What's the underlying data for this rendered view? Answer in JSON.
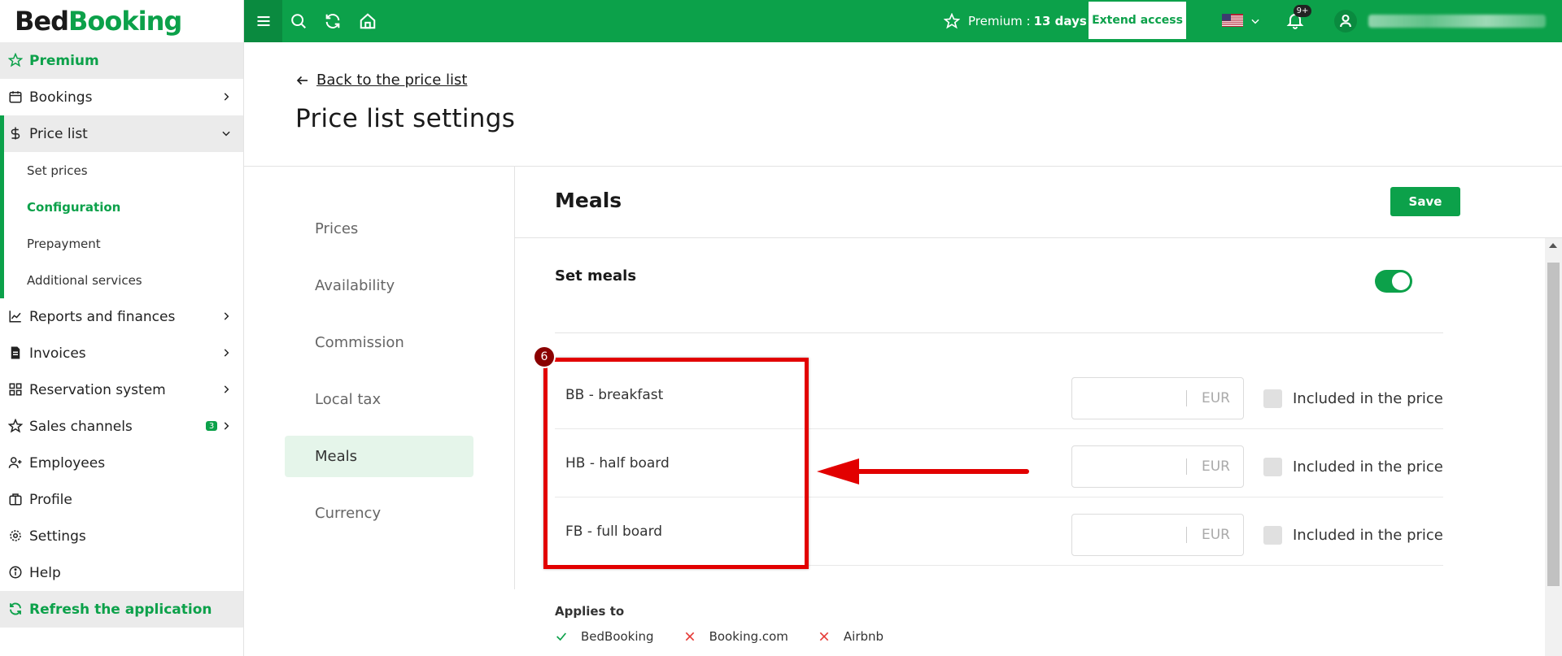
{
  "brand": {
    "part1": "Bed",
    "part2": "Booking"
  },
  "sidebar": {
    "items": [
      {
        "label": "Premium",
        "icon": "star-icon"
      },
      {
        "label": "Bookings",
        "icon": "calendar-icon"
      },
      {
        "label": "Price list",
        "icon": "dollar-icon"
      },
      {
        "label": "Reports and finances",
        "icon": "chart-icon"
      },
      {
        "label": "Invoices",
        "icon": "invoice-icon"
      },
      {
        "label": "Reservation system",
        "icon": "grid-icon"
      },
      {
        "label": "Sales channels",
        "icon": "star-icon",
        "badge": "3"
      },
      {
        "label": "Employees",
        "icon": "user-plus-icon"
      },
      {
        "label": "Profile",
        "icon": "building-icon"
      },
      {
        "label": "Settings",
        "icon": "gear-icon"
      },
      {
        "label": "Help",
        "icon": "info-icon"
      },
      {
        "label": "Refresh the application",
        "icon": "refresh-icon"
      }
    ],
    "price_list_sub": [
      "Set prices",
      "Configuration",
      "Prepayment",
      "Additional services"
    ]
  },
  "topbar": {
    "premium_label": "Premium :",
    "premium_days": "13 days",
    "extend_label": "Extend access",
    "notification_count": "9+"
  },
  "header": {
    "back_label": "Back to the price list",
    "title": "Price list settings"
  },
  "settings_nav": [
    "Prices",
    "Availability",
    "Commission",
    "Local tax",
    "Meals",
    "Currency"
  ],
  "main": {
    "title": "Meals",
    "save_label": "Save",
    "set_meals_label": "Set meals",
    "set_meals_enabled": true,
    "meals": [
      {
        "name": "BB - breakfast",
        "currency": "EUR",
        "included_label": "Included in the price"
      },
      {
        "name": "HB - half board",
        "currency": "EUR",
        "included_label": "Included in the price"
      },
      {
        "name": "FB - full board",
        "currency": "EUR",
        "included_label": "Included in the price"
      }
    ],
    "applies_label": "Applies to",
    "applies": [
      {
        "name": "BedBooking",
        "enabled": true
      },
      {
        "name": "Booking.com",
        "enabled": false
      },
      {
        "name": "Airbnb",
        "enabled": false
      }
    ]
  },
  "annotation": {
    "step": "6"
  },
  "colors": {
    "brand_green": "#0ca14a",
    "annotation_red": "#e20000"
  }
}
